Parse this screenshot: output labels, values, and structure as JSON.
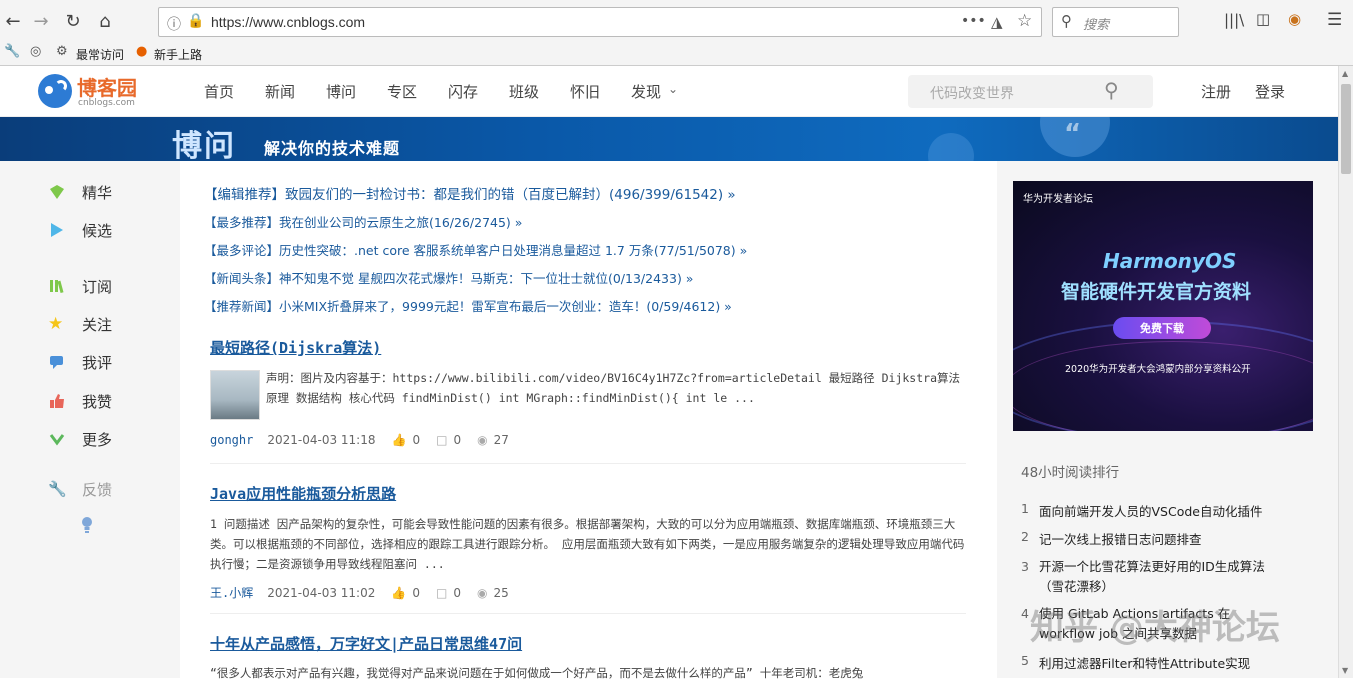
{
  "browser": {
    "url": "https://www.cnblogs.com",
    "search_placeholder": "搜索",
    "bookmarks": [
      "最常访问",
      "新手上路"
    ]
  },
  "site": {
    "logo_text": "博客园",
    "logo_sub": "cnblogs.com",
    "nav": [
      "首页",
      "新闻",
      "博问",
      "专区",
      "闪存",
      "班级",
      "怀旧",
      "发现"
    ],
    "search_placeholder": "代码改变世界",
    "register": "注册",
    "login": "登录"
  },
  "banner": {
    "title": "博问",
    "slogan": "解决你的技术难题"
  },
  "sidebar": {
    "items": [
      {
        "label": "精华",
        "icon": "gem-icon",
        "color": "#7ec84a"
      },
      {
        "label": "候选",
        "icon": "play-icon",
        "color": "#4fb6e8"
      },
      {
        "label": "订阅",
        "icon": "books-icon",
        "color": "#7ec84a"
      },
      {
        "label": "关注",
        "icon": "star-icon",
        "color": "#f5c518"
      },
      {
        "label": "我评",
        "icon": "comment-icon",
        "color": "#4a90d9"
      },
      {
        "label": "我赞",
        "icon": "thumbs-up-icon",
        "color": "#e8665a"
      },
      {
        "label": "更多",
        "icon": "chevron-down-icon",
        "color": "#5cb85c"
      },
      {
        "label": "反馈",
        "icon": "wrench-icon",
        "color": "#999999"
      }
    ]
  },
  "recommendations": [
    "【编辑推荐】致园友们的一封检讨书：都是我们的错（百度已解封）(496/399/61542) »",
    "【最多推荐】我在创业公司的云原生之旅(16/26/2745) »",
    "【最多评论】历史性突破：.net core 客服系统单客户日处理消息量超过 1.7 万条(77/51/5078) »",
    "【新闻头条】神不知鬼不觉 星舰四次花式爆炸！马斯克：下一位壮士就位(0/13/2433) »",
    "【推荐新闻】小米MIX折叠屏来了，9999元起！雷军宣布最后一次创业：造车！(0/59/4612) »"
  ],
  "posts": [
    {
      "title": "最短路径(Dijskra算法)",
      "summary": "声明：图片及内容基于：https://www.bilibili.com/video/BV16C4y1H7Zc?from=articleDetail 最短路径 Dijkstra算法 原理 数据结构 核心代码 findMinDist() int MGraph::findMinDist(){ int le ...",
      "author": "gonghr",
      "time": "2021-04-03 11:18",
      "likes": "0",
      "comments": "0",
      "views": "27"
    },
    {
      "title": "Java应用性能瓶颈分析思路",
      "summary": "1 问题描述 因产品架构的复杂性，可能会导致性能问题的因素有很多。根据部署架构，大致的可以分为应用端瓶颈、数据库端瓶颈、环境瓶颈三大类。可以根据瓶颈的不同部位，选择相应的跟踪工具进行跟踪分析。 应用层面瓶颈大致有如下两类，一是应用服务端复杂的逻辑处理导致应用端代码执行慢；二是资源锁争用导致线程阻塞问 ...",
      "author": "王.小辉",
      "time": "2021-04-03 11:02",
      "likes": "0",
      "comments": "0",
      "views": "25"
    },
    {
      "title": "十年从产品感悟，万字好文|产品日常思维47问",
      "summary": "“很多人都表示对产品有兴趣，我觉得对产品来说问题在于如何做成一个好产品，而不是去做什么样的产品”  十年老司机：老虎兔"
    }
  ],
  "ad": {
    "source": "华为开发者论坛",
    "title_en": "HarmonyOS",
    "title_cn": "智能硬件开发官方资料",
    "button": "免费下载",
    "footer": "2020华为开发者大会鸿蒙内部分享资料公开"
  },
  "ranking": {
    "title": "48小时阅读排行",
    "items": [
      {
        "n": "1",
        "text": "面向前端开发人员的VSCode自动化插件"
      },
      {
        "n": "2",
        "text": "记一次线上报错日志问题排查"
      },
      {
        "n": "3",
        "text": "开源一个比雪花算法更好用的ID生成算法（雪花漂移）"
      },
      {
        "n": "4",
        "text": "使用 GitLab Actions artifacts 在 workflow job 之间共享数据"
      },
      {
        "n": "5",
        "text": "利用过滤器Filter和特性Attribute实现"
      }
    ]
  },
  "watermark": "知乎 @大神论坛"
}
